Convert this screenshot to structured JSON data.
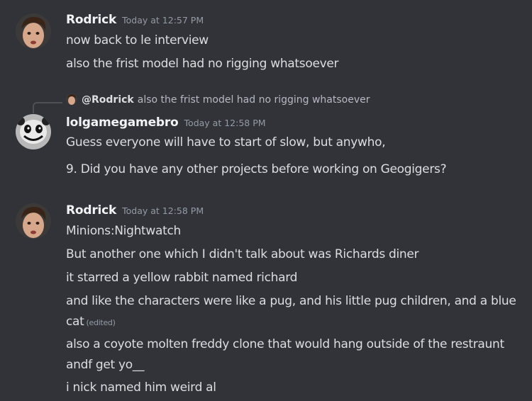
{
  "messages": [
    {
      "author": "Rodrick",
      "timestamp": "Today at 12:57 PM",
      "lines": [
        "now back to le interview",
        "also the frist model had no rigging whatsoever"
      ]
    },
    {
      "reply": {
        "mention": "@Rodrick",
        "text": "also the frist model had no rigging whatsoever"
      },
      "author": "lolgamegamebro",
      "timestamp": "Today at 12:58 PM",
      "lines": [
        "Guess everyone will have to start of slow, but anywho,",
        "9. Did you have any other projects before working on Geogigers?"
      ]
    },
    {
      "author": "Rodrick",
      "timestamp": "Today at 12:58 PM",
      "lines": [
        "Minions:Nightwatch",
        "But another one which I didn't talk about was Richards diner",
        "it starred a yellow rabbit named richard",
        "and like the characters were like a pug, and his little pug children, and a blue cat",
        "also a coyote molten freddy clone that would hang outside of the restraunt andf get yo__",
        "i nick named him weird al"
      ],
      "edited_label": "(edited)"
    }
  ],
  "colors": {
    "background": "#313338",
    "username": "#f2f3f5",
    "text": "#dbdee1",
    "muted": "#949ba4"
  }
}
